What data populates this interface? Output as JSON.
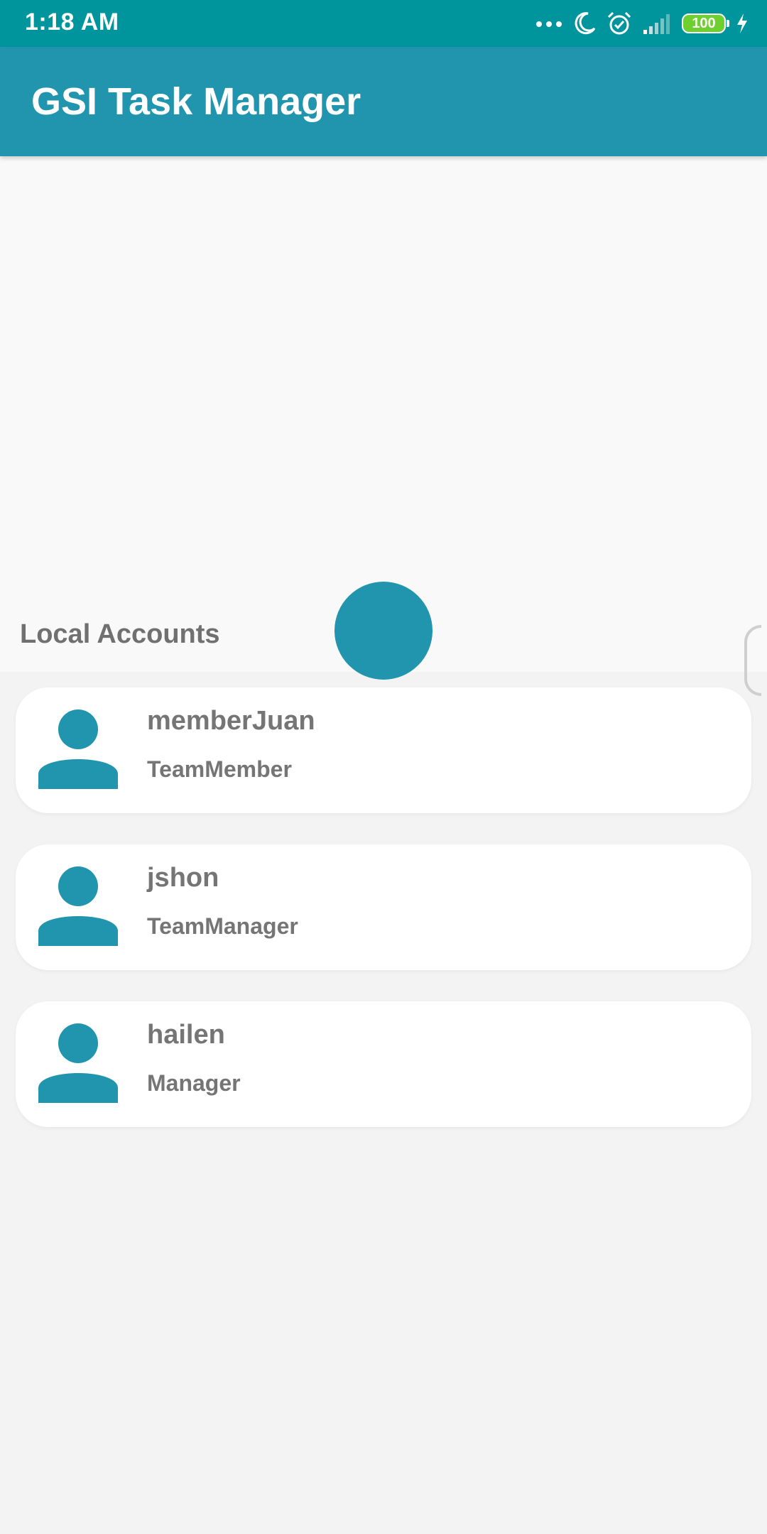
{
  "status_bar": {
    "time": "1:18 AM",
    "battery": "100",
    "icons": [
      "more-dots-icon",
      "moon-icon",
      "alarm-icon",
      "signal-icon",
      "battery-icon",
      "charging-bolt-icon"
    ]
  },
  "app_bar": {
    "title": "GSI Task Manager"
  },
  "hero": {
    "add_account_icon": "add-user-icon",
    "section_title": "Local Accounts"
  },
  "accounts": [
    {
      "name": "memberJuan",
      "role": "TeamMember",
      "icon": "user-avatar-icon"
    },
    {
      "name": "jshon",
      "role": "TeamManager",
      "icon": "user-avatar-icon"
    },
    {
      "name": "hailen",
      "role": "Manager",
      "icon": "user-avatar-icon"
    }
  ],
  "colors": {
    "status_bar": "#00959c",
    "app_bar": "#2194ae",
    "accent": "#2194ae",
    "text_secondary": "#757575",
    "background": "#f3f3f3"
  }
}
